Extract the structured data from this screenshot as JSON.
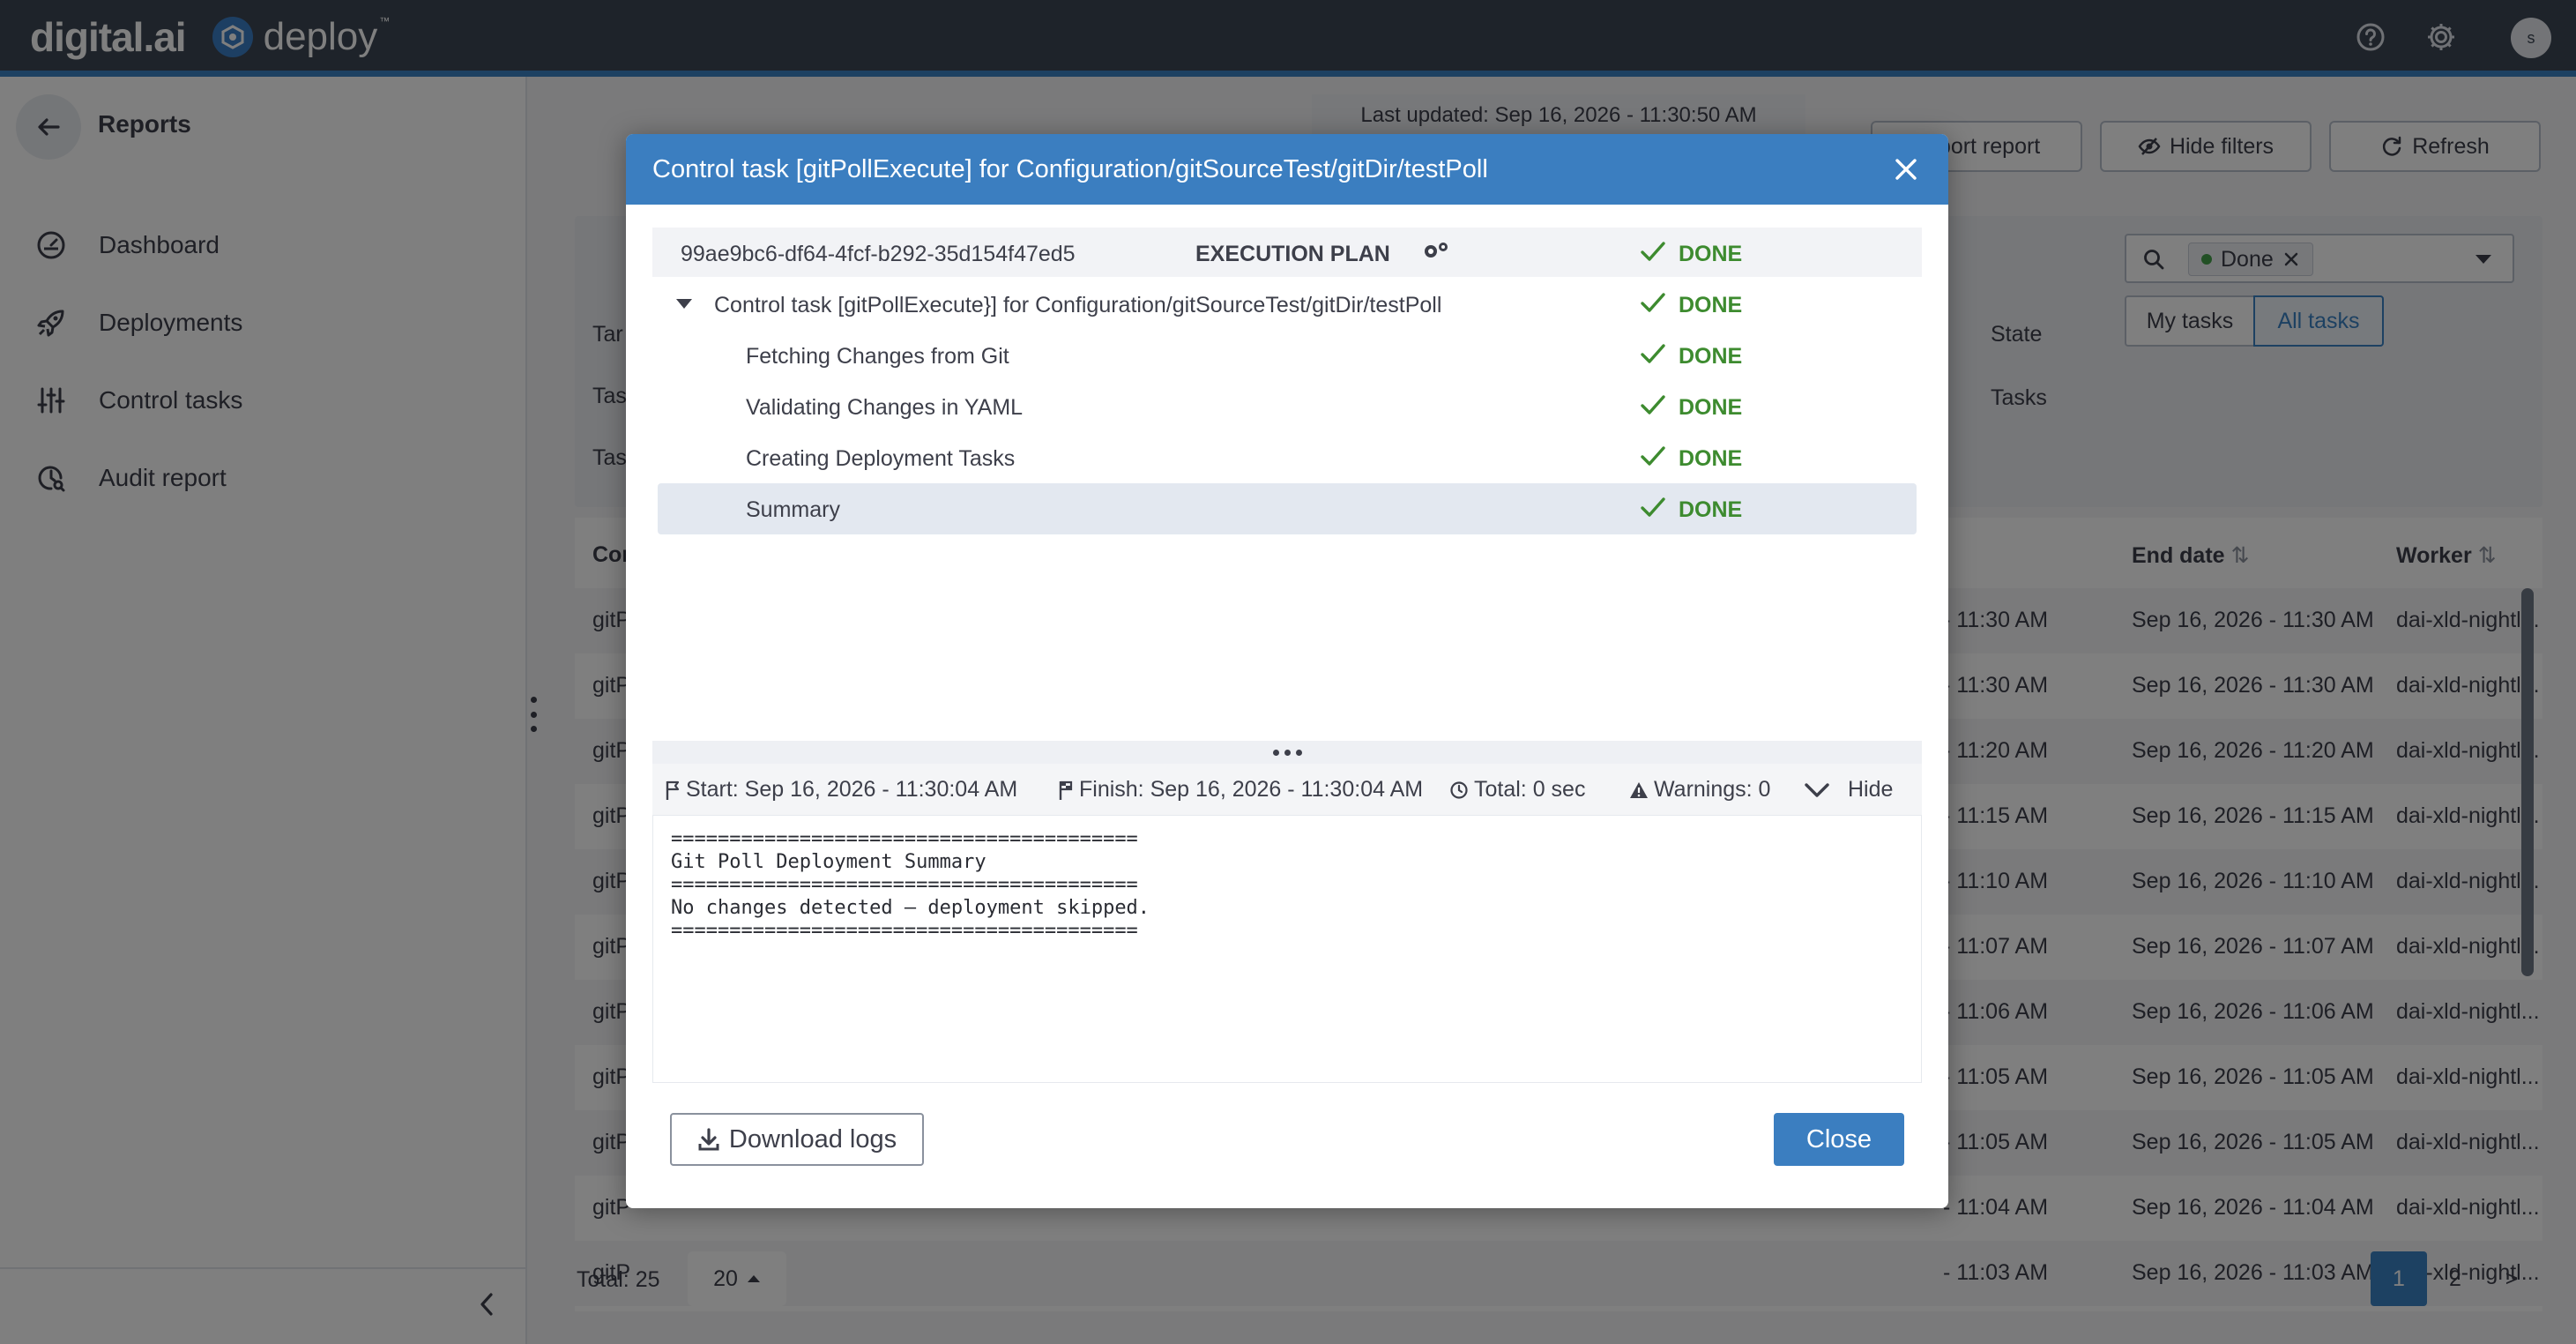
{
  "app": {
    "logo_digital": "digital.ai",
    "logo_deploy": "deploy",
    "logo_tm": "™",
    "avatar_initial": "s",
    "accent_color": "#3b82c4",
    "topbar_color": "#3d4654",
    "icons": {
      "help": "question-circle-icon",
      "settings": "gear-icon"
    }
  },
  "sidebar": {
    "title": "Reports",
    "items": [
      {
        "label": "Dashboard",
        "icon": "dashboard-icon"
      },
      {
        "label": "Deployments",
        "icon": "rocket-icon"
      },
      {
        "label": "Control tasks",
        "icon": "sliders-icon"
      },
      {
        "label": "Audit report",
        "icon": "audit-icon"
      }
    ]
  },
  "page": {
    "last_updated": "Last updated: Sep 16, 2026 - 11:30:50 AM",
    "export_label": "Export report",
    "hide_filters_label": "Hide filters",
    "refresh_label": "Refresh",
    "filters": {
      "left_labels": [
        "Tar",
        "Tas",
        "Tas"
      ],
      "state_label": "State",
      "state_chip": "Done",
      "tasks_label": "Tasks",
      "my_tasks": "My tasks",
      "all_tasks": "All tasks"
    },
    "table": {
      "first_col_header": "Cor",
      "end_date_header": "End date",
      "worker_header": "Worker",
      "rows": [
        {
          "first": "gitP",
          "start": "- 11:30 AM",
          "end": "Sep 16, 2026 - 11:30 AM",
          "worker": "dai-xld-nightl..."
        },
        {
          "first": "gitP",
          "start": "- 11:30 AM",
          "end": "Sep 16, 2026 - 11:30 AM",
          "worker": "dai-xld-nightl..."
        },
        {
          "first": "gitP",
          "start": "- 11:20 AM",
          "end": "Sep 16, 2026 - 11:20 AM",
          "worker": "dai-xld-nightl..."
        },
        {
          "first": "gitP",
          "start": "- 11:15 AM",
          "end": "Sep 16, 2026 - 11:15 AM",
          "worker": "dai-xld-nightl..."
        },
        {
          "first": "gitP",
          "start": "- 11:10 AM",
          "end": "Sep 16, 2026 - 11:10 AM",
          "worker": "dai-xld-nightl..."
        },
        {
          "first": "gitP",
          "start": "- 11:07 AM",
          "end": "Sep 16, 2026 - 11:07 AM",
          "worker": "dai-xld-nightl..."
        },
        {
          "first": "gitP",
          "start": "- 11:06 AM",
          "end": "Sep 16, 2026 - 11:06 AM",
          "worker": "dai-xld-nightl..."
        },
        {
          "first": "gitP",
          "start": "- 11:05 AM",
          "end": "Sep 16, 2026 - 11:05 AM",
          "worker": "dai-xld-nightl..."
        },
        {
          "first": "gitP",
          "start": "- 11:05 AM",
          "end": "Sep 16, 2026 - 11:05 AM",
          "worker": "dai-xld-nightl..."
        },
        {
          "first": "gitP",
          "start": "- 11:04 AM",
          "end": "Sep 16, 2026 - 11:04 AM",
          "worker": "dai-xld-nightl..."
        },
        {
          "first": "gitP",
          "start": "- 11:03 AM",
          "end": "Sep 16, 2026 - 11:03 AM",
          "worker": "dai-xld-nightl..."
        }
      ]
    },
    "total": "Total: 25",
    "page_size": "20",
    "pages": [
      "1",
      "2",
      ">"
    ]
  },
  "modal": {
    "title": "Control task [gitPollExecute] for Configuration/gitSourceTest/gitDir/testPoll",
    "task_id": "99ae9bc6-df64-4fcf-b292-35d154f47ed5",
    "execution_plan_label": "EXECUTION PLAN",
    "root_step": "Control task [gitPollExecute}] for Configuration/gitSourceTest/gitDir/testPoll",
    "steps": [
      {
        "label": "Fetching Changes from Git",
        "state": "DONE"
      },
      {
        "label": "Validating Changes in YAML",
        "state": "DONE"
      },
      {
        "label": "Creating Deployment Tasks",
        "state": "DONE"
      },
      {
        "label": "Summary",
        "state": "DONE"
      }
    ],
    "plan_state": "DONE",
    "root_state": "DONE",
    "done_color": "#3d8b2f",
    "start": "Start: Sep 16, 2026 - 11:30:04 AM",
    "finish": "Finish: Sep 16, 2026 - 11:30:04 AM",
    "total": "Total: 0 sec",
    "warnings": "Warnings: 0",
    "hide_label": "Hide",
    "log": "========================================\nGit Poll Deployment Summary\n========================================\nNo changes detected — deployment skipped.\n========================================",
    "download_label": "Download logs",
    "close_label": "Close"
  }
}
